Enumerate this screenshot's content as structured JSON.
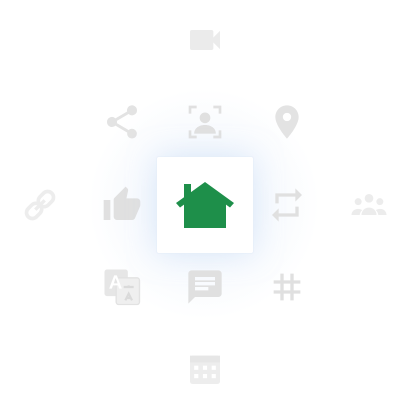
{
  "colors": {
    "background": "#ffffff",
    "center_icon": "#1e8f4a",
    "dim_icon": "#d9d9d9",
    "faint_icon": "#ebebeb",
    "glow": "#e4eefb"
  },
  "center": {
    "icon": "home-icon"
  },
  "icons": [
    {
      "name": "video-camera-icon",
      "ring": "outer",
      "direction": "top"
    },
    {
      "name": "share-icon",
      "ring": "inner",
      "direction": "top-left"
    },
    {
      "name": "person-frame-icon",
      "ring": "inner",
      "direction": "top"
    },
    {
      "name": "location-pin-icon",
      "ring": "inner",
      "direction": "top-right"
    },
    {
      "name": "link-icon",
      "ring": "outer",
      "direction": "left"
    },
    {
      "name": "thumbs-up-icon",
      "ring": "inner",
      "direction": "left"
    },
    {
      "name": "repeat-icon",
      "ring": "inner",
      "direction": "right"
    },
    {
      "name": "group-icon",
      "ring": "outer",
      "direction": "right"
    },
    {
      "name": "translate-icon",
      "ring": "inner",
      "direction": "bottom-left"
    },
    {
      "name": "chat-icon",
      "ring": "inner",
      "direction": "bottom"
    },
    {
      "name": "hashtag-icon",
      "ring": "inner",
      "direction": "bottom-right"
    },
    {
      "name": "calendar-icon",
      "ring": "outer",
      "direction": "bottom"
    }
  ]
}
